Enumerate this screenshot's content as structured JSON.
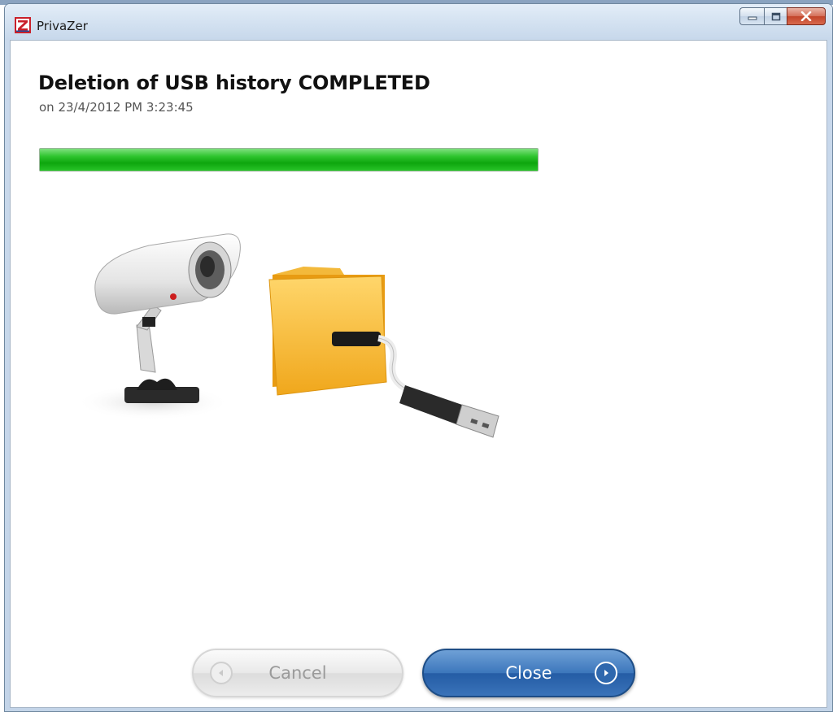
{
  "window": {
    "title": "PrivaZer",
    "icons": {
      "app": "privazer-z-icon",
      "minimize": "minimize-icon",
      "maximize": "maximize-icon",
      "close": "close-icon"
    }
  },
  "main": {
    "heading": "Deletion of USB history COMPLETED",
    "subheading": "on 23/4/2012 PM 3:23:45",
    "progress": {
      "percent": 100,
      "color": "#1fb81f"
    },
    "illustration": {
      "camera": "security-camera-icon",
      "folder": "folder-icon",
      "cable": "usb-cable-icon"
    }
  },
  "buttons": {
    "cancel_label": "Cancel",
    "close_label": "Close",
    "cancel_icon": "left-arrow-circle-icon",
    "close_icon": "right-arrow-circle-icon"
  }
}
